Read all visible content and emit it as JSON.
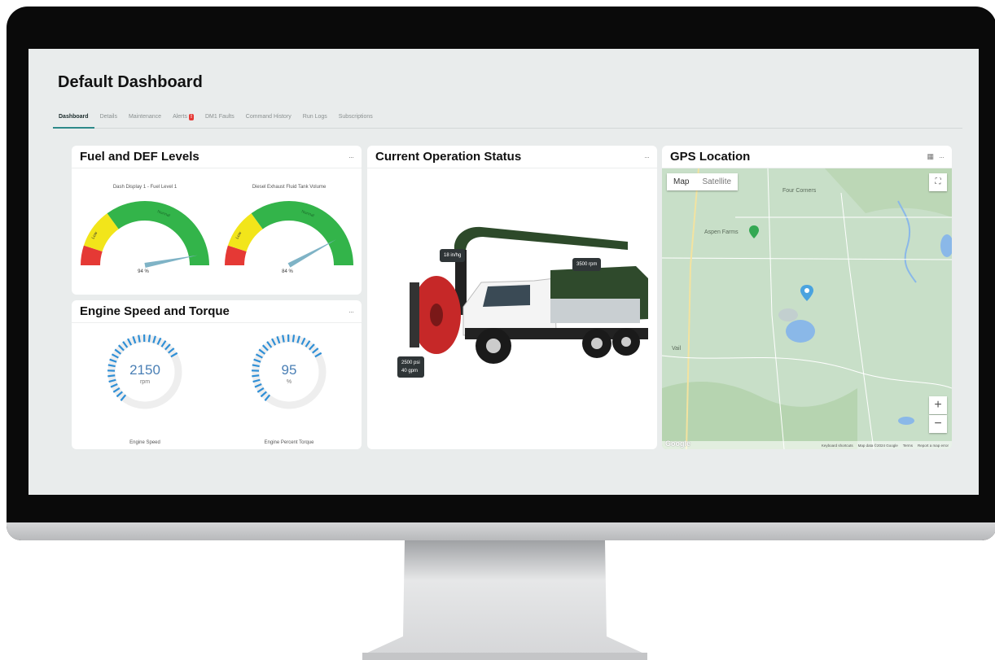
{
  "page_title": "Default Dashboard",
  "tabs": [
    {
      "label": "Dashboard"
    },
    {
      "label": "Details"
    },
    {
      "label": "Maintenance"
    },
    {
      "label": "Alerts"
    },
    {
      "label": "DM1 Faults"
    },
    {
      "label": "Command History"
    },
    {
      "label": "Run Logs"
    },
    {
      "label": "Subscriptions"
    }
  ],
  "alerts_badge": "!",
  "fuel_card": {
    "title": "Fuel and DEF Levels",
    "menu": "···",
    "gauges": [
      {
        "label": "Dash Display 1 - Fuel Level 1",
        "value_text": "94 %",
        "value": 94,
        "zone_low": "Low",
        "zone_normal": "Normal"
      },
      {
        "label": "Diesel Exhaust Fluid Tank Volume",
        "value_text": "84 %",
        "value": 84,
        "zone_low": "Low",
        "zone_normal": "Normal"
      }
    ]
  },
  "engine_card": {
    "title": "Engine Speed and Torque",
    "menu": "···",
    "rings": [
      {
        "value": "2150",
        "unit": "rpm",
        "caption": "Engine Speed",
        "fraction": 0.55
      },
      {
        "value": "95",
        "unit": "%",
        "caption": "Engine Percent Torque",
        "fraction": 0.55
      }
    ]
  },
  "operation_card": {
    "title": "Current Operation Status",
    "menu": "···",
    "callouts": {
      "vacuum": "18 in/hg",
      "rpm": "3500 rpm",
      "pressure": "2500 psi",
      "flow": "40 gpm"
    }
  },
  "gps_card": {
    "title": "GPS Location",
    "menu": "···",
    "map_btn": "Map",
    "satellite_btn": "Satellite",
    "places": {
      "four_corners": "Four Corners",
      "aspen_farms": "Aspen Farms",
      "vail": "Vail"
    },
    "footer": {
      "shortcuts": "Keyboard shortcuts",
      "map_data": "Map data ©2024 Google",
      "terms": "Terms",
      "report": "Report a map error"
    },
    "logo": "Google",
    "zoom_in": "+",
    "zoom_out": "−"
  },
  "colors": {
    "gauge_green": "#33b44a",
    "gauge_yellow": "#f2e51a",
    "gauge_red": "#e53935",
    "ring_blue": "#2f8fd6",
    "tab_accent": "#2e8a8a"
  }
}
